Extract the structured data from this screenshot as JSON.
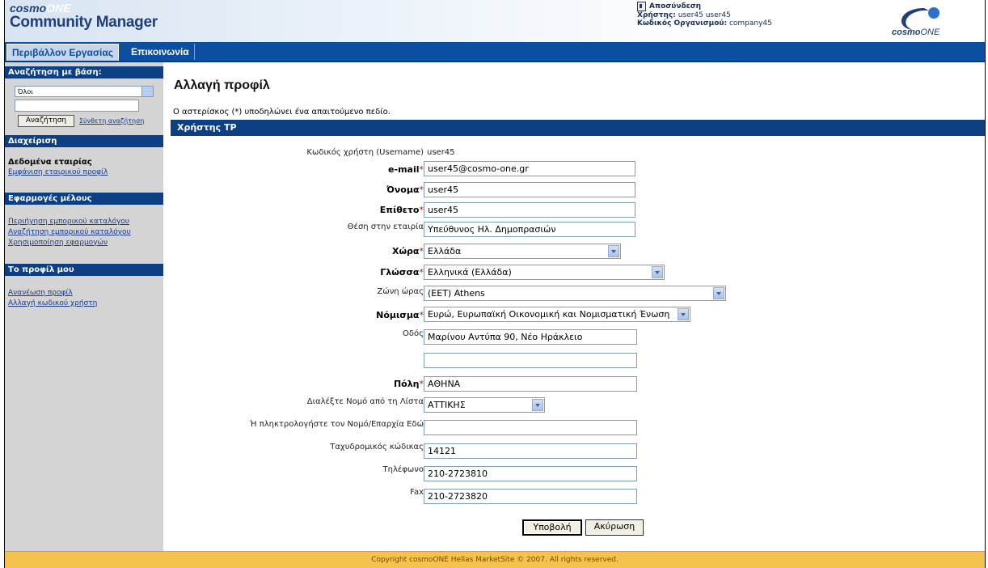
{
  "header": {
    "brand_top_a": "cosmo",
    "brand_top_b": "ONE",
    "brand_bottom": "Community Manager",
    "logout_label": "Αποσύνδεση",
    "user_label": "Χρήστης:",
    "user_value": "user45 user45",
    "org_label": "Κωδικός Οργανισμού:",
    "org_value": "company45",
    "logo_text_a": "cosmo",
    "logo_text_b": "ONE"
  },
  "nav": {
    "tabs": [
      {
        "label": "Περιβάλλον Εργασίας",
        "active": true
      },
      {
        "label": "Επικοινωνία",
        "active": false
      }
    ]
  },
  "sidebar": {
    "search_head": "Αναζήτηση με βάση:",
    "search_select": "Όλοι",
    "search_button": "Αναζήτηση",
    "advanced_search": "Σύνθετη αναζήτηση",
    "admin_head": "Διαχείριση",
    "company_data": "Δεδομένα εταιρίας",
    "company_profile_link": "Εμφάνιση εταιρικού προφίλ",
    "member_apps_head": "Εφαρμογές μέλους",
    "member_links": [
      "Περιήγηση εμπορικού καταλόγου",
      "Αναζήτηση εμπορικού καταλόγου",
      "Χρησιμοποίηση εφαρμογών"
    ],
    "profile_head": "Το προφίλ μου",
    "profile_links": [
      "Ανανέωση προφίλ",
      "Αλλαγή κωδικού χρήστη"
    ]
  },
  "main": {
    "title": "Αλλαγή προφίλ",
    "required_note": "Ο αστερίσκος (*) υποδηλώνει ένα απαιτούμενο πεδίο.",
    "section": "Χρήστης TP",
    "username_label": "Κωδικός χρήστη (Username)",
    "username_value": "user45",
    "email_label": "e-mail",
    "email_value": "user45@cosmo-one.gr",
    "first_name_label": "Όνομα",
    "first_name_value": "user45",
    "last_name_label": "Επίθετο",
    "last_name_value": "user45",
    "position_label": "Θέση στην εταιρία",
    "position_value": "Υπεύθυνος Ηλ. Δημοπρασιών",
    "country_label": "Χώρα",
    "country_value": "Ελλάδα",
    "language_label": "Γλώσσα",
    "language_value": "Ελληνικά (Ελλάδα)",
    "timezone_label": "Ζώνη ώρας",
    "timezone_value": "(EET) Athens",
    "currency_label": "Νόμισμα",
    "currency_value": "Ευρώ, Ευρωπαϊκή Οικονομική και Νομισματική Ένωση",
    "street_label": "Οδός",
    "street_value": "Μαρίνου Αντύπα 90, Νέο Ηράκλειο",
    "street2_value": "",
    "city_label": "Πόλη",
    "city_value": "ΑΘΗΝΑ",
    "prefecture_label": "Διαλέξτε Νομό από τη Λίστα",
    "prefecture_value": "ΑΤΤΙΚΗΣ",
    "prefecture_text_label": "Ή πληκτρολογήστε τον Νομό/Επαρχία Εδώ",
    "prefecture_text_value": "",
    "zip_label": "Ταχυδρομικός κώδικας",
    "zip_value": "14121",
    "phone_label": "Τηλέφωνο",
    "phone_value": "210-2723810",
    "fax_label": "Fax",
    "fax_value": "210-2723820",
    "required_star": "*",
    "submit": "Υποβολή",
    "cancel": "Ακύρωση"
  },
  "footer": {
    "text": "Copyright cosmoONE Hellas MarketSite © 2007. All rights reserved."
  },
  "colors": {
    "nav_blue": "#0c4fa1",
    "section_blue": "#0d3f85",
    "footer_yellow": "#f4c24d",
    "sidebar_grey": "#d4d4d4",
    "required_red": "#d00000"
  }
}
